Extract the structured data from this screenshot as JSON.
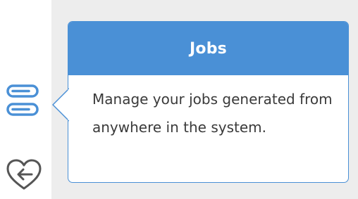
{
  "sidebar": {
    "items": [
      {
        "icon": "jobs-icon"
      },
      {
        "icon": "heart-return-icon"
      }
    ]
  },
  "tooltip": {
    "title": "Jobs",
    "description": "Manage your jobs generated from anywhere in the system."
  },
  "colors": {
    "accent": "#4a90d6",
    "background": "#ededed",
    "text": "#3a3a3a"
  }
}
